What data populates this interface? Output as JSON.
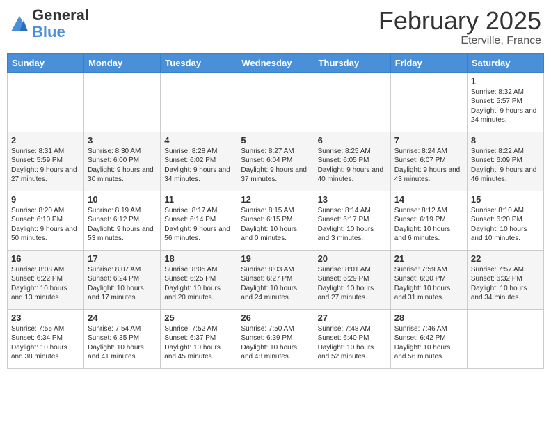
{
  "header": {
    "logo_general": "General",
    "logo_blue": "Blue",
    "month_title": "February 2025",
    "location": "Eterville, France"
  },
  "days_of_week": [
    "Sunday",
    "Monday",
    "Tuesday",
    "Wednesday",
    "Thursday",
    "Friday",
    "Saturday"
  ],
  "weeks": [
    [
      {
        "day": "",
        "info": ""
      },
      {
        "day": "",
        "info": ""
      },
      {
        "day": "",
        "info": ""
      },
      {
        "day": "",
        "info": ""
      },
      {
        "day": "",
        "info": ""
      },
      {
        "day": "",
        "info": ""
      },
      {
        "day": "1",
        "info": "Sunrise: 8:32 AM\nSunset: 5:57 PM\nDaylight: 9 hours and 24 minutes."
      }
    ],
    [
      {
        "day": "2",
        "info": "Sunrise: 8:31 AM\nSunset: 5:59 PM\nDaylight: 9 hours and 27 minutes."
      },
      {
        "day": "3",
        "info": "Sunrise: 8:30 AM\nSunset: 6:00 PM\nDaylight: 9 hours and 30 minutes."
      },
      {
        "day": "4",
        "info": "Sunrise: 8:28 AM\nSunset: 6:02 PM\nDaylight: 9 hours and 34 minutes."
      },
      {
        "day": "5",
        "info": "Sunrise: 8:27 AM\nSunset: 6:04 PM\nDaylight: 9 hours and 37 minutes."
      },
      {
        "day": "6",
        "info": "Sunrise: 8:25 AM\nSunset: 6:05 PM\nDaylight: 9 hours and 40 minutes."
      },
      {
        "day": "7",
        "info": "Sunrise: 8:24 AM\nSunset: 6:07 PM\nDaylight: 9 hours and 43 minutes."
      },
      {
        "day": "8",
        "info": "Sunrise: 8:22 AM\nSunset: 6:09 PM\nDaylight: 9 hours and 46 minutes."
      }
    ],
    [
      {
        "day": "9",
        "info": "Sunrise: 8:20 AM\nSunset: 6:10 PM\nDaylight: 9 hours and 50 minutes."
      },
      {
        "day": "10",
        "info": "Sunrise: 8:19 AM\nSunset: 6:12 PM\nDaylight: 9 hours and 53 minutes."
      },
      {
        "day": "11",
        "info": "Sunrise: 8:17 AM\nSunset: 6:14 PM\nDaylight: 9 hours and 56 minutes."
      },
      {
        "day": "12",
        "info": "Sunrise: 8:15 AM\nSunset: 6:15 PM\nDaylight: 10 hours and 0 minutes."
      },
      {
        "day": "13",
        "info": "Sunrise: 8:14 AM\nSunset: 6:17 PM\nDaylight: 10 hours and 3 minutes."
      },
      {
        "day": "14",
        "info": "Sunrise: 8:12 AM\nSunset: 6:19 PM\nDaylight: 10 hours and 6 minutes."
      },
      {
        "day": "15",
        "info": "Sunrise: 8:10 AM\nSunset: 6:20 PM\nDaylight: 10 hours and 10 minutes."
      }
    ],
    [
      {
        "day": "16",
        "info": "Sunrise: 8:08 AM\nSunset: 6:22 PM\nDaylight: 10 hours and 13 minutes."
      },
      {
        "day": "17",
        "info": "Sunrise: 8:07 AM\nSunset: 6:24 PM\nDaylight: 10 hours and 17 minutes."
      },
      {
        "day": "18",
        "info": "Sunrise: 8:05 AM\nSunset: 6:25 PM\nDaylight: 10 hours and 20 minutes."
      },
      {
        "day": "19",
        "info": "Sunrise: 8:03 AM\nSunset: 6:27 PM\nDaylight: 10 hours and 24 minutes."
      },
      {
        "day": "20",
        "info": "Sunrise: 8:01 AM\nSunset: 6:29 PM\nDaylight: 10 hours and 27 minutes."
      },
      {
        "day": "21",
        "info": "Sunrise: 7:59 AM\nSunset: 6:30 PM\nDaylight: 10 hours and 31 minutes."
      },
      {
        "day": "22",
        "info": "Sunrise: 7:57 AM\nSunset: 6:32 PM\nDaylight: 10 hours and 34 minutes."
      }
    ],
    [
      {
        "day": "23",
        "info": "Sunrise: 7:55 AM\nSunset: 6:34 PM\nDaylight: 10 hours and 38 minutes."
      },
      {
        "day": "24",
        "info": "Sunrise: 7:54 AM\nSunset: 6:35 PM\nDaylight: 10 hours and 41 minutes."
      },
      {
        "day": "25",
        "info": "Sunrise: 7:52 AM\nSunset: 6:37 PM\nDaylight: 10 hours and 45 minutes."
      },
      {
        "day": "26",
        "info": "Sunrise: 7:50 AM\nSunset: 6:39 PM\nDaylight: 10 hours and 48 minutes."
      },
      {
        "day": "27",
        "info": "Sunrise: 7:48 AM\nSunset: 6:40 PM\nDaylight: 10 hours and 52 minutes."
      },
      {
        "day": "28",
        "info": "Sunrise: 7:46 AM\nSunset: 6:42 PM\nDaylight: 10 hours and 56 minutes."
      },
      {
        "day": "",
        "info": ""
      }
    ]
  ]
}
